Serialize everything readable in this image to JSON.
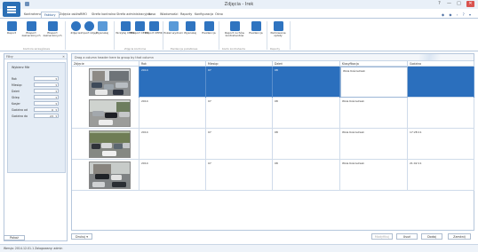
{
  "window": {
    "title": "Zdjęcia - Irek",
    "controls": [
      "?",
      "—",
      "□",
      "✕"
    ]
  },
  "ribbon": {
    "tabs": [
      "Kontrahenci",
      "Faktury",
      "Zdjęcia osiów",
      "RMO",
      "Strefa kontrolna",
      "Strefa administracyjna",
      "Kasa",
      "Wiadomości",
      "Raporty",
      "Konfiguracja",
      "Okno"
    ],
    "active_tab": 1,
    "right_icons": "◆ ◆ ‹ ? ▾",
    "buttons": [
      {
        "label": "Raport"
      },
      {
        "label": "Eksport zaznaczonych"
      },
      {
        "label": "Eksport zaznaczonych"
      },
      {
        "label": "Zdjęcie"
      },
      {
        "label": "Import zdjęć"
      },
      {
        "label": "Wyszukaj"
      },
      {
        "label": "Wczytaj CEPIK"
      },
      {
        "label": "Eksport CEPIK"
      },
      {
        "label": "Import CEPIK"
      },
      {
        "label": "Pokaż wydruki"
      },
      {
        "label": "Wyszukaj"
      },
      {
        "label": "Ewidencja"
      },
      {
        "label": "Raport ruchów kontrahentów"
      },
      {
        "label": "Ewidencja"
      },
      {
        "label": "Parkowanie opłaty"
      }
    ],
    "groups": [
      "Kontrola szczegółowa",
      "Zdjęcia kontrolne",
      "Ewidencje podatkowe",
      "Konto kontrahenta",
      "Raporty"
    ]
  },
  "left_panel": {
    "title": "Filtry",
    "filter_title": "Wybierz filtr",
    "fields": [
      {
        "label": "Rok",
        "value": ""
      },
      {
        "label": "Miesiąc",
        "value": ""
      },
      {
        "label": "Dzień",
        "value": ""
      },
      {
        "label": "Sklep",
        "value": ""
      },
      {
        "label": "Kasjer",
        "value": ""
      },
      {
        "label": "Godzina od",
        "value": "0"
      },
      {
        "label": "Godzina do",
        "value": "23"
      }
    ],
    "show_button": "Pokaż"
  },
  "grid": {
    "group_hint": "Drag a column header here to group by that column",
    "columns": [
      "Zdjęcie",
      "Rok",
      "Miesiąc",
      "Dzień",
      "Klasyfikacja",
      "Godzina"
    ],
    "rows": [
      {
        "rok": "2014",
        "miesiac": "07",
        "dzien": "08",
        "klas": "Wola Kościelniak",
        "godzina": ""
      },
      {
        "rok": "2014",
        "miesiac": "07",
        "dzien": "08",
        "klas": "Wola Kościelniak",
        "godzina": ""
      },
      {
        "rok": "2014",
        "miesiac": "07",
        "dzien": "08",
        "klas": "Wola Kościelniak",
        "godzina": "17:28:11"
      },
      {
        "rok": "2014",
        "miesiac": "07",
        "dzien": "08",
        "klas": "Wola Kościelniak",
        "godzina": "21:02:11"
      }
    ],
    "selected_row": 0
  },
  "bottom_bar": {
    "print_label": "Drukuj",
    "buttons": [
      "Modyfikuj",
      "Usuń",
      "Dodaj",
      "Zamknij"
    ]
  },
  "status": {
    "text": "Wersja: 2014.12.01.1   Zalogowany: admin"
  },
  "colors": {
    "accent": "#2b6fbd",
    "ribbon_icon": "#2f74c0",
    "panel_bg": "#e4ecf5"
  }
}
